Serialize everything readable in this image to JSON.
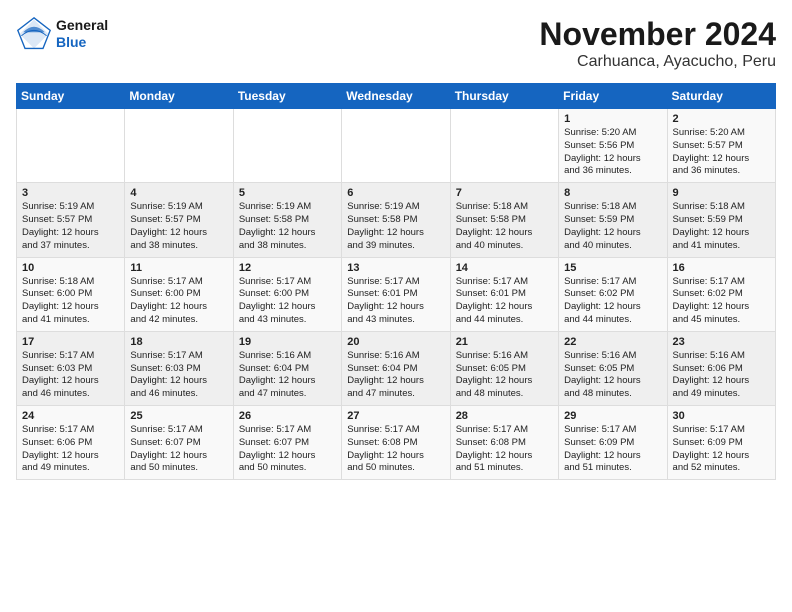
{
  "header": {
    "logo_general": "General",
    "logo_blue": "Blue",
    "title": "November 2024",
    "subtitle": "Carhuanca, Ayacucho, Peru"
  },
  "calendar": {
    "days_of_week": [
      "Sunday",
      "Monday",
      "Tuesday",
      "Wednesday",
      "Thursday",
      "Friday",
      "Saturday"
    ],
    "weeks": [
      [
        {
          "day": "",
          "info": ""
        },
        {
          "day": "",
          "info": ""
        },
        {
          "day": "",
          "info": ""
        },
        {
          "day": "",
          "info": ""
        },
        {
          "day": "",
          "info": ""
        },
        {
          "day": "1",
          "info": "Sunrise: 5:20 AM\nSunset: 5:56 PM\nDaylight: 12 hours\nand 36 minutes."
        },
        {
          "day": "2",
          "info": "Sunrise: 5:20 AM\nSunset: 5:57 PM\nDaylight: 12 hours\nand 36 minutes."
        }
      ],
      [
        {
          "day": "3",
          "info": "Sunrise: 5:19 AM\nSunset: 5:57 PM\nDaylight: 12 hours\nand 37 minutes."
        },
        {
          "day": "4",
          "info": "Sunrise: 5:19 AM\nSunset: 5:57 PM\nDaylight: 12 hours\nand 38 minutes."
        },
        {
          "day": "5",
          "info": "Sunrise: 5:19 AM\nSunset: 5:58 PM\nDaylight: 12 hours\nand 38 minutes."
        },
        {
          "day": "6",
          "info": "Sunrise: 5:19 AM\nSunset: 5:58 PM\nDaylight: 12 hours\nand 39 minutes."
        },
        {
          "day": "7",
          "info": "Sunrise: 5:18 AM\nSunset: 5:58 PM\nDaylight: 12 hours\nand 40 minutes."
        },
        {
          "day": "8",
          "info": "Sunrise: 5:18 AM\nSunset: 5:59 PM\nDaylight: 12 hours\nand 40 minutes."
        },
        {
          "day": "9",
          "info": "Sunrise: 5:18 AM\nSunset: 5:59 PM\nDaylight: 12 hours\nand 41 minutes."
        }
      ],
      [
        {
          "day": "10",
          "info": "Sunrise: 5:18 AM\nSunset: 6:00 PM\nDaylight: 12 hours\nand 41 minutes."
        },
        {
          "day": "11",
          "info": "Sunrise: 5:17 AM\nSunset: 6:00 PM\nDaylight: 12 hours\nand 42 minutes."
        },
        {
          "day": "12",
          "info": "Sunrise: 5:17 AM\nSunset: 6:00 PM\nDaylight: 12 hours\nand 43 minutes."
        },
        {
          "day": "13",
          "info": "Sunrise: 5:17 AM\nSunset: 6:01 PM\nDaylight: 12 hours\nand 43 minutes."
        },
        {
          "day": "14",
          "info": "Sunrise: 5:17 AM\nSunset: 6:01 PM\nDaylight: 12 hours\nand 44 minutes."
        },
        {
          "day": "15",
          "info": "Sunrise: 5:17 AM\nSunset: 6:02 PM\nDaylight: 12 hours\nand 44 minutes."
        },
        {
          "day": "16",
          "info": "Sunrise: 5:17 AM\nSunset: 6:02 PM\nDaylight: 12 hours\nand 45 minutes."
        }
      ],
      [
        {
          "day": "17",
          "info": "Sunrise: 5:17 AM\nSunset: 6:03 PM\nDaylight: 12 hours\nand 46 minutes."
        },
        {
          "day": "18",
          "info": "Sunrise: 5:17 AM\nSunset: 6:03 PM\nDaylight: 12 hours\nand 46 minutes."
        },
        {
          "day": "19",
          "info": "Sunrise: 5:16 AM\nSunset: 6:04 PM\nDaylight: 12 hours\nand 47 minutes."
        },
        {
          "day": "20",
          "info": "Sunrise: 5:16 AM\nSunset: 6:04 PM\nDaylight: 12 hours\nand 47 minutes."
        },
        {
          "day": "21",
          "info": "Sunrise: 5:16 AM\nSunset: 6:05 PM\nDaylight: 12 hours\nand 48 minutes."
        },
        {
          "day": "22",
          "info": "Sunrise: 5:16 AM\nSunset: 6:05 PM\nDaylight: 12 hours\nand 48 minutes."
        },
        {
          "day": "23",
          "info": "Sunrise: 5:16 AM\nSunset: 6:06 PM\nDaylight: 12 hours\nand 49 minutes."
        }
      ],
      [
        {
          "day": "24",
          "info": "Sunrise: 5:17 AM\nSunset: 6:06 PM\nDaylight: 12 hours\nand 49 minutes."
        },
        {
          "day": "25",
          "info": "Sunrise: 5:17 AM\nSunset: 6:07 PM\nDaylight: 12 hours\nand 50 minutes."
        },
        {
          "day": "26",
          "info": "Sunrise: 5:17 AM\nSunset: 6:07 PM\nDaylight: 12 hours\nand 50 minutes."
        },
        {
          "day": "27",
          "info": "Sunrise: 5:17 AM\nSunset: 6:08 PM\nDaylight: 12 hours\nand 50 minutes."
        },
        {
          "day": "28",
          "info": "Sunrise: 5:17 AM\nSunset: 6:08 PM\nDaylight: 12 hours\nand 51 minutes."
        },
        {
          "day": "29",
          "info": "Sunrise: 5:17 AM\nSunset: 6:09 PM\nDaylight: 12 hours\nand 51 minutes."
        },
        {
          "day": "30",
          "info": "Sunrise: 5:17 AM\nSunset: 6:09 PM\nDaylight: 12 hours\nand 52 minutes."
        }
      ]
    ]
  }
}
